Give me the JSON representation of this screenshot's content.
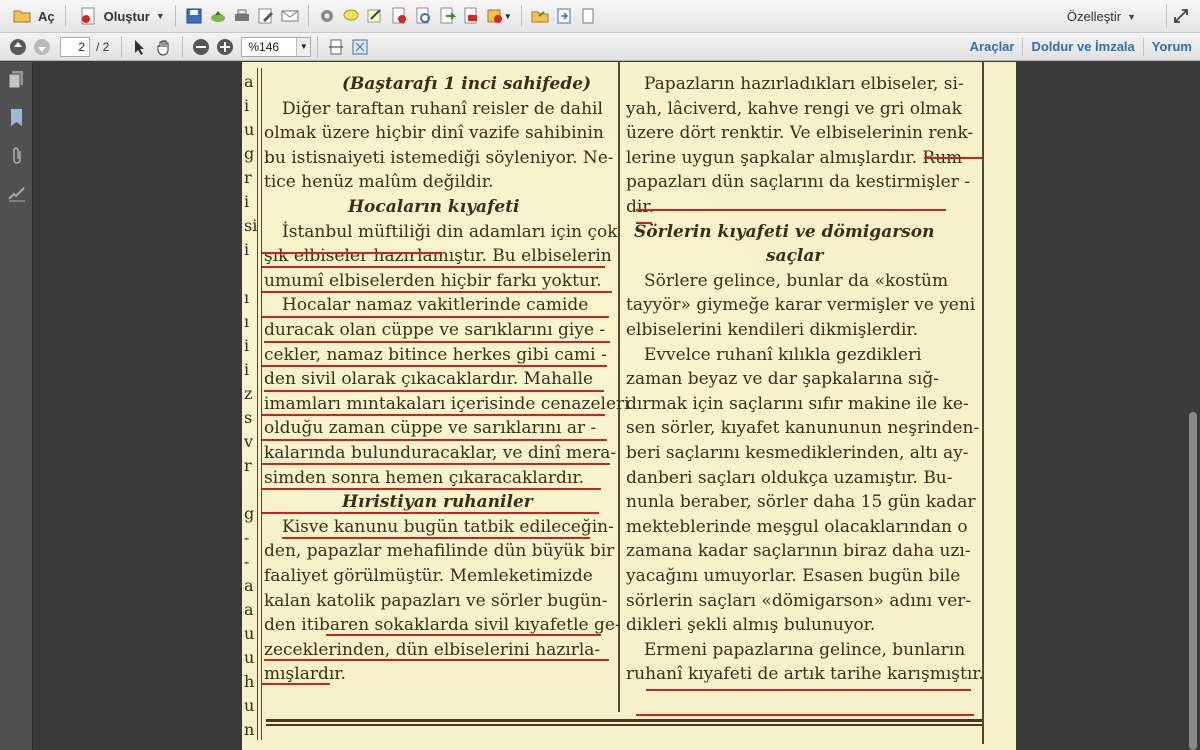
{
  "toolbar": {
    "open_label": "Aç",
    "create_label": "Oluştur",
    "customize_label": "Özelleştir"
  },
  "nav": {
    "current_page": "2",
    "total_pages": "/ 2",
    "zoom": "%146"
  },
  "right_panel_links": {
    "tools": "Araçlar",
    "fill_sign": "Doldur ve İmzala",
    "comment": "Yorum"
  },
  "icons": {
    "toolbar1": [
      "open-folder-icon",
      "create-pdf-icon",
      "save-icon",
      "upload-cloud-icon",
      "print-icon",
      "edit-icon",
      "email-icon",
      "settings-icon",
      "comment-bubble-icon",
      "sign-icon",
      "delete-page-icon",
      "protect-icon",
      "export-icon",
      "redact-icon",
      "organize-icon",
      "open-file-icon",
      "send-icon",
      "page-icon",
      "fullscreen-icon"
    ],
    "toolbar2": [
      "page-up-icon",
      "page-down-icon",
      "select-cursor-icon",
      "hand-tool-icon",
      "zoom-out-icon",
      "zoom-in-icon",
      "fit-width-icon",
      "fit-page-icon"
    ],
    "left_nav": [
      "page-thumbnails-icon",
      "bookmarks-icon",
      "attachments-icon",
      "signatures-icon"
    ]
  },
  "colors": {
    "underline": "#d21f1f",
    "link": "#2f6fb5",
    "paper": "#f5f1c8",
    "ink": "#3d2c18"
  },
  "document": {
    "edge_fragments": [
      "a",
      "i",
      "u",
      "g",
      "r",
      "i",
      "si",
      "i",
      "",
      "ı",
      "ı",
      "i",
      "i",
      "z",
      "s",
      "v",
      "r",
      "",
      "g",
      "-",
      "-",
      "a",
      "a",
      "u",
      "u",
      "h",
      "u",
      "n"
    ],
    "left_column": {
      "lines": [
        {
          "text": "(Baştarafı 1 inci sahifede)",
          "style": "hd",
          "indent": 78
        },
        {
          "text": "Diğer taraftan ruhanî reisler de dahil",
          "indent": 18
        },
        {
          "text": "olmak üzere hiçbir dinî vazife sahibinin",
          "indent": 0
        },
        {
          "text": "bu istisnaiyeti istemediği söyleniyor. Ne-",
          "indent": 0
        },
        {
          "text": "tice henüz malûm değildir.",
          "indent": 0
        },
        {
          "text": "Hocaların kıyafeti",
          "style": "hd",
          "indent": 84
        },
        {
          "text": "İstanbul müftiliği din adamları için çok",
          "indent": 18
        },
        {
          "text": "şık elbiseler hazırlamıştır. Bu elbiselerin",
          "indent": 0
        },
        {
          "text": "umumî elbiselerden hiçbir farkı yoktur.",
          "indent": 0
        },
        {
          "text": "Hocalar namaz vakitlerinde   camide",
          "indent": 18
        },
        {
          "text": "duracak olan cüppe ve sarıklarını giye -",
          "indent": 0
        },
        {
          "text": "cekler, namaz bitince herkes gibi cami -",
          "indent": 0
        },
        {
          "text": "den sivil olarak çıkacaklardır. Mahalle",
          "indent": 0
        },
        {
          "text": "imamları mıntakaları içerisinde cenazeleri",
          "indent": 0
        },
        {
          "text": "olduğu zaman cüppe ve sarıklarını ar -",
          "indent": 0
        },
        {
          "text": "kalarında bulunduracaklar, ve dinî mera-",
          "indent": 0
        },
        {
          "text": "simden sonra hemen çıkaracaklardır.",
          "indent": 0
        },
        {
          "text": "Hıristiyan ruhaniler",
          "style": "hd",
          "indent": 78
        },
        {
          "text": "Kisve kanunu bugün tatbik edileceğin-",
          "indent": 18
        },
        {
          "text": "den, papazlar mehafilinde dün büyük bir",
          "indent": 0
        },
        {
          "text": "faaliyet   görülmüştür.   Memleketimizde",
          "indent": 0
        },
        {
          "text": "kalan katolik papazları ve sörler bugün-",
          "indent": 0
        },
        {
          "text": "den itibaren sokaklarda sivil kıyafetle ge-",
          "indent": 0
        },
        {
          "text": "zeceklerinden, dün   elbiselerini hazırla-",
          "indent": 0
        },
        {
          "text": "mışlardır.",
          "indent": 0
        }
      ]
    },
    "right_column": {
      "lines": [
        {
          "text": "Papazların hazırladıkları elbiseler, si-",
          "indent": 18
        },
        {
          "text": "yah, lâciverd, kahve rengi ve gri olmak",
          "indent": 0
        },
        {
          "text": "üzere dört renktir. Ve elbiselerinin renk-",
          "indent": 0
        },
        {
          "text": "lerine uygun şapkalar almışlardır. Rum",
          "indent": 0
        },
        {
          "text": "papazları dün saçlarını da kestirmişler -",
          "indent": 0
        },
        {
          "text": "dir.",
          "indent": 0
        },
        {
          "text": "Sörlerin kıyafeti ve dömigarson",
          "style": "hd",
          "indent": 8
        },
        {
          "text": "saçlar",
          "style": "hd",
          "indent": 140
        },
        {
          "text": "Sörlere gelince,  bunlar da «kostüm",
          "indent": 18
        },
        {
          "text": "tayyör» giymeğe karar vermişler ve yeni",
          "indent": 0
        },
        {
          "text": "elbiselerini kendileri dikmişlerdir.",
          "indent": 0
        },
        {
          "text": "Evvelce ruhanî   kılıkla  gezdikleri",
          "indent": 18
        },
        {
          "text": "zaman  beyaz ve dar  şapkalarına sığ-",
          "indent": 0
        },
        {
          "text": "dırmak için saçlarını sıfır makine ile ke-",
          "indent": 0
        },
        {
          "text": "sen sörler, kıyafet kanununun neşrinden-",
          "indent": 0
        },
        {
          "text": "beri saçlarını kesmediklerinden, altı ay-",
          "indent": 0
        },
        {
          "text": "danberi saçları oldukça  uzamıştır. Bu-",
          "indent": 0
        },
        {
          "text": "nunla beraber, sörler daha 15 gün kadar",
          "indent": 0
        },
        {
          "text": "mekteblerinde meşgul  olacaklarından o",
          "indent": 0
        },
        {
          "text": "zamana kadar saçlarının biraz daha uzı-",
          "indent": 0
        },
        {
          "text": "yacağını umuyorlar.  Esasen bugün bile",
          "indent": 0
        },
        {
          "text": "sörlerin saçları «dömigarson» adını ver-",
          "indent": 0
        },
        {
          "text": "dikleri şekli almış bulunuyor.",
          "indent": 0
        },
        {
          "text": "Ermeni papazlarına gelince, bunların",
          "indent": 18
        },
        {
          "text": "ruhanî kıyafeti de artık tarihe karışmıştır.",
          "indent": 0
        }
      ]
    }
  }
}
